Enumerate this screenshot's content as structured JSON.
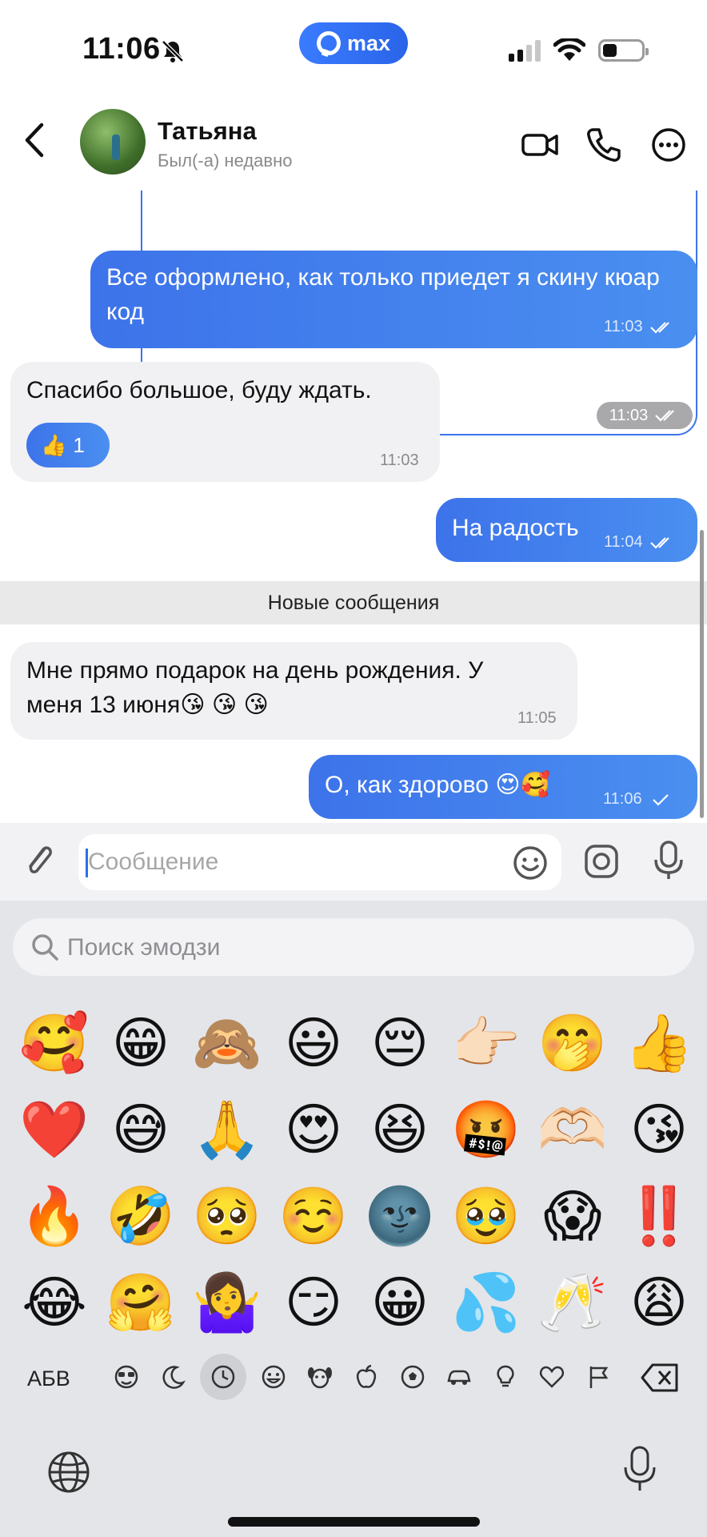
{
  "status_bar": {
    "time": "11:06",
    "app_badge": "max"
  },
  "header": {
    "contact_name": "Татьяна",
    "contact_status": "Был(-а) недавно"
  },
  "messages": [
    {
      "direction": "out",
      "text": "",
      "time": "11:03",
      "read": true
    },
    {
      "direction": "out",
      "text": "Все оформлено, как только приедет я скину кюар код",
      "time": "11:03",
      "read": true
    },
    {
      "direction": "in",
      "text": "Спасибо большое, буду ждать.",
      "time": "11:03",
      "reaction_emoji": "👍",
      "reaction_count": "1"
    },
    {
      "direction": "out",
      "text": "На радость",
      "time": "11:04",
      "read": true
    },
    {
      "direction": "in",
      "text": "Мне прямо подарок на день рождения. У меня 13 июня😘 😘 😘",
      "time": "11:05"
    },
    {
      "direction": "out",
      "text": "О, как здорово 😍🥰",
      "time": "11:06",
      "read": false
    }
  ],
  "new_messages_divider": "Новые сообщения",
  "composer": {
    "placeholder": "Сообщение"
  },
  "emoji_keyboard": {
    "search_placeholder": "Поиск эмодзи",
    "abc_label": "АБВ",
    "emojis": [
      "🥰",
      "😁",
      "🙈",
      "😃",
      "😔",
      "👉🏻",
      "🤭",
      "👍",
      "❤️",
      "😅",
      "🙏",
      "😍",
      "😆",
      "🤬",
      "🫶🏻",
      "😘",
      "🔥",
      "🤣",
      "🥺",
      "☺️",
      "🌚",
      "🥹",
      "😱",
      "‼️",
      "😂",
      "🤗",
      "🤷‍♀️",
      "😏",
      "😀",
      "💦",
      "🥂",
      "😩"
    ],
    "categories": [
      "smileys-icon",
      "moon-icon",
      "recent-icon",
      "emoji-icon",
      "animal-icon",
      "apple-icon",
      "ball-icon",
      "car-icon",
      "bulb-icon",
      "heart-icon",
      "flag-icon"
    ],
    "active_category": "recent-icon"
  },
  "colors": {
    "accent": "#3d73ea",
    "incoming_bubble": "#f1f1f3",
    "divider_bg": "#e9e9ea"
  }
}
